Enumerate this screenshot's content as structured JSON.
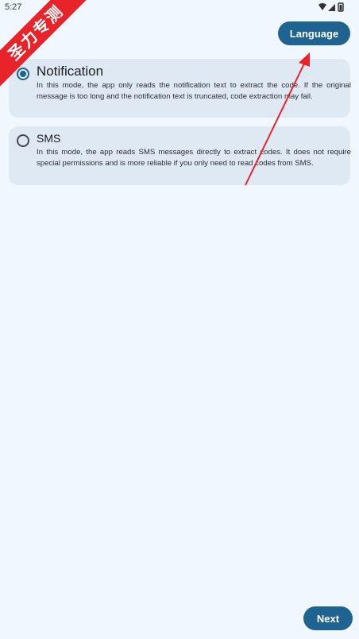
{
  "status_bar": {
    "time": "5:27",
    "icons": [
      "wifi-icon",
      "signal-icon",
      "battery-icon"
    ]
  },
  "header": {
    "language_button": "Language"
  },
  "options": [
    {
      "title": "Notification",
      "description": "In this mode, the app only reads the notification text to extract the code. If the original message is too long and the notification text is truncated, code extraction may fail.",
      "selected": true
    },
    {
      "title": "SMS",
      "description": "In this mode, the app reads SMS messages directly to extract codes. It does not require special permissions and is more reliable if you only need to read codes from SMS.",
      "selected": false
    }
  ],
  "footer": {
    "next_button": "Next"
  },
  "watermark": {
    "text": "圣力专测"
  },
  "colors": {
    "background": "#f1f7fe",
    "card": "#dfe9f4",
    "accent": "#1f6390",
    "watermark": "#e8232a",
    "annotation_arrow": "#e8232a"
  }
}
